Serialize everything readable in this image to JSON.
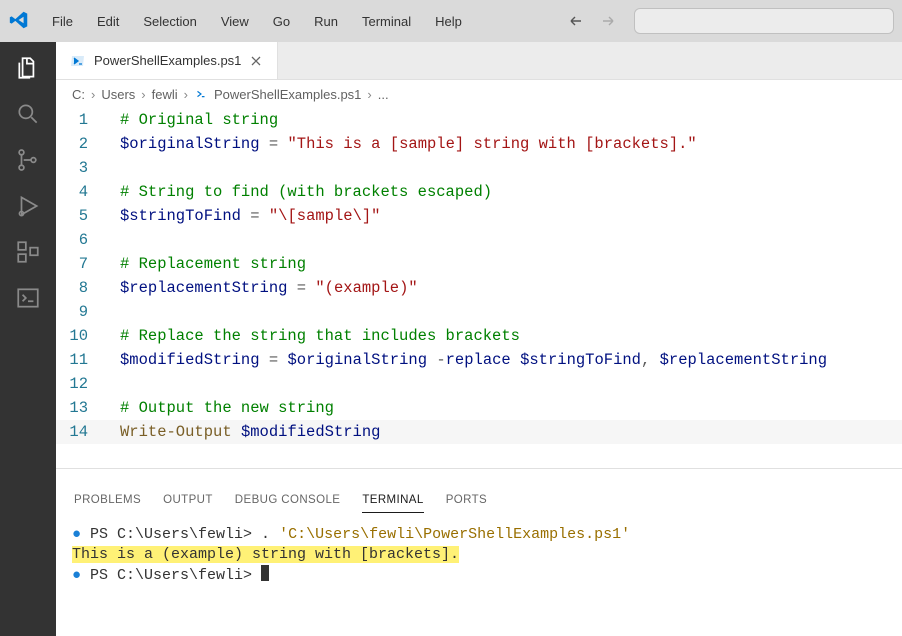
{
  "menu": {
    "items": [
      "File",
      "Edit",
      "Selection",
      "View",
      "Go",
      "Run",
      "Terminal",
      "Help"
    ]
  },
  "tab": {
    "filename": "PowerShellExamples.ps1"
  },
  "breadcrumb": {
    "parts": [
      "C:",
      "Users",
      "fewli",
      "PowerShellExamples.ps1",
      "..."
    ]
  },
  "code": {
    "lines": [
      {
        "n": 1,
        "tokens": [
          [
            "c",
            "# Original string"
          ]
        ]
      },
      {
        "n": 2,
        "tokens": [
          [
            "v",
            "$originalString"
          ],
          [
            "p",
            " "
          ],
          [
            "op",
            "="
          ],
          [
            "p",
            " "
          ],
          [
            "s",
            "\"This is a [sample] string with [brackets].\""
          ]
        ]
      },
      {
        "n": 3,
        "tokens": []
      },
      {
        "n": 4,
        "tokens": [
          [
            "c",
            "# String to find (with brackets escaped)"
          ]
        ]
      },
      {
        "n": 5,
        "tokens": [
          [
            "v",
            "$stringToFind"
          ],
          [
            "p",
            " "
          ],
          [
            "op",
            "="
          ],
          [
            "p",
            " "
          ],
          [
            "s",
            "\"\\[sample\\]\""
          ]
        ]
      },
      {
        "n": 6,
        "tokens": []
      },
      {
        "n": 7,
        "tokens": [
          [
            "c",
            "# Replacement string"
          ]
        ]
      },
      {
        "n": 8,
        "tokens": [
          [
            "v",
            "$replacementString"
          ],
          [
            "p",
            " "
          ],
          [
            "op",
            "="
          ],
          [
            "p",
            " "
          ],
          [
            "s",
            "\"(example)\""
          ]
        ]
      },
      {
        "n": 9,
        "tokens": []
      },
      {
        "n": 10,
        "tokens": [
          [
            "c",
            "# Replace the string that includes brackets"
          ]
        ]
      },
      {
        "n": 11,
        "tokens": [
          [
            "v",
            "$modifiedString"
          ],
          [
            "p",
            " "
          ],
          [
            "op",
            "="
          ],
          [
            "p",
            " "
          ],
          [
            "v",
            "$originalString"
          ],
          [
            "p",
            " "
          ],
          [
            "op",
            "-"
          ],
          [
            "k",
            "replace"
          ],
          [
            "p",
            " "
          ],
          [
            "v",
            "$stringToFind"
          ],
          [
            "op",
            ","
          ],
          [
            "p",
            " "
          ],
          [
            "v",
            "$replacementString"
          ]
        ]
      },
      {
        "n": 12,
        "tokens": []
      },
      {
        "n": 13,
        "tokens": [
          [
            "c",
            "# Output the new string"
          ]
        ]
      },
      {
        "n": 14,
        "hl": true,
        "tokens": [
          [
            "cmd",
            "Write-Output"
          ],
          [
            "p",
            " "
          ],
          [
            "v",
            "$modifiedString"
          ]
        ]
      }
    ]
  },
  "panel": {
    "tabs": [
      "PROBLEMS",
      "OUTPUT",
      "DEBUG CONSOLE",
      "TERMINAL",
      "PORTS"
    ],
    "active": "TERMINAL"
  },
  "terminal": {
    "l1_prompt": "PS C:\\Users\\fewli> ",
    "l1_dot": ". ",
    "l1_path": "'C:\\Users\\fewli\\PowerShellExamples.ps1'",
    "l2_output": "This is a (example) string with [brackets].",
    "l3_prompt": "PS C:\\Users\\fewli> "
  }
}
